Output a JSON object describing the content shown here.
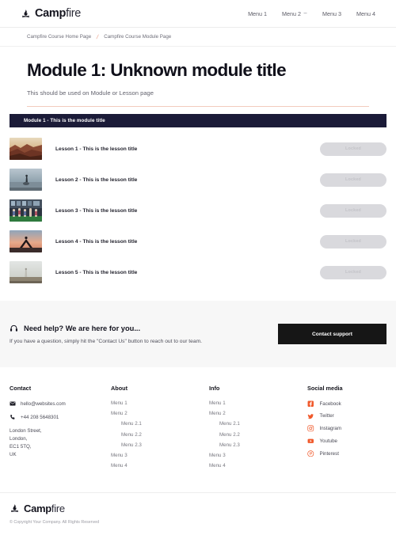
{
  "header": {
    "logo": {
      "bold": "Camp",
      "light": "fire",
      "icon": "campfire-icon"
    },
    "nav": [
      {
        "label": "Menu 1",
        "has_dropdown": false
      },
      {
        "label": "Menu 2",
        "has_dropdown": true
      },
      {
        "label": "Menu 3",
        "has_dropdown": false
      },
      {
        "label": "Menu 4",
        "has_dropdown": false
      }
    ]
  },
  "breadcrumb": {
    "items": [
      "Campfire Course Home Page",
      "Campfire Course Module Page"
    ],
    "separator": "/",
    "separator_color": "#e89a83"
  },
  "page": {
    "title": "Module 1: Unknown module title",
    "subtitle": "This should be used on Module or Lesson page"
  },
  "module": {
    "bar_label": "Module 1 - This is the module title",
    "bar_bg": "#1b1b38",
    "lessons": [
      {
        "title": "Lesson 1 - This is the lesson title",
        "button": "Locked",
        "thumb": "desert-canyon-photo"
      },
      {
        "title": "Lesson 2 - This is the lesson title",
        "button": "Locked",
        "thumb": "beach-person-photo"
      },
      {
        "title": "Lesson 3 - This is the lesson title",
        "button": "Locked",
        "thumb": "yoga-class-photo"
      },
      {
        "title": "Lesson 4 - This is the lesson title",
        "button": "Locked",
        "thumb": "yoga-sunset-photo"
      },
      {
        "title": "Lesson 5 - This is the lesson title",
        "button": "Locked",
        "thumb": "field-person-photo"
      }
    ]
  },
  "help": {
    "icon": "headset-icon",
    "heading": "Need help? We are here for you...",
    "subtext": "If you have a question, simply hit the \"Contact Us\" button to reach out to our team.",
    "button_label": "Contact support",
    "button_bg": "#161616",
    "strip_bg": "#f7f7f7"
  },
  "footer": {
    "contact": {
      "heading": "Contact",
      "email": "hello@websites.com",
      "email_icon": "envelope-icon",
      "phone": "+44 208 5648301",
      "phone_icon": "phone-icon",
      "address": [
        "London Street,",
        "London,",
        "EC1 5TQ,",
        "UK"
      ]
    },
    "about": {
      "heading": "About",
      "items": [
        {
          "label": "Menu 1",
          "sub": false
        },
        {
          "label": "Menu 2",
          "sub": false
        },
        {
          "label": "Menu 2.1",
          "sub": true
        },
        {
          "label": "Menu 2.2",
          "sub": true
        },
        {
          "label": "Menu 2.3",
          "sub": true
        },
        {
          "label": "Menu 3",
          "sub": false
        },
        {
          "label": "Menu 4",
          "sub": false
        }
      ]
    },
    "info": {
      "heading": "Info",
      "items": [
        {
          "label": "Menu 1",
          "sub": false
        },
        {
          "label": "Menu 2",
          "sub": false
        },
        {
          "label": "Menu 2.1",
          "sub": true
        },
        {
          "label": "Menu 2.2",
          "sub": true
        },
        {
          "label": "Menu 2.3",
          "sub": true
        },
        {
          "label": "Menu 3",
          "sub": false
        },
        {
          "label": "Menu 4",
          "sub": false
        }
      ]
    },
    "social": {
      "heading": "Social media",
      "icon_color": "#f0592b",
      "items": [
        {
          "label": "Facebook",
          "icon": "facebook-icon"
        },
        {
          "label": "Twitter",
          "icon": "twitter-icon"
        },
        {
          "label": "Instagram",
          "icon": "instagram-icon"
        },
        {
          "label": "Youtube",
          "icon": "youtube-icon"
        },
        {
          "label": "Pinterest",
          "icon": "pinterest-icon"
        }
      ]
    }
  },
  "bottom": {
    "logo": {
      "bold": "Camp",
      "light": "fire"
    },
    "copyright": "© Copyright Your Company. All Rights Reserved"
  }
}
